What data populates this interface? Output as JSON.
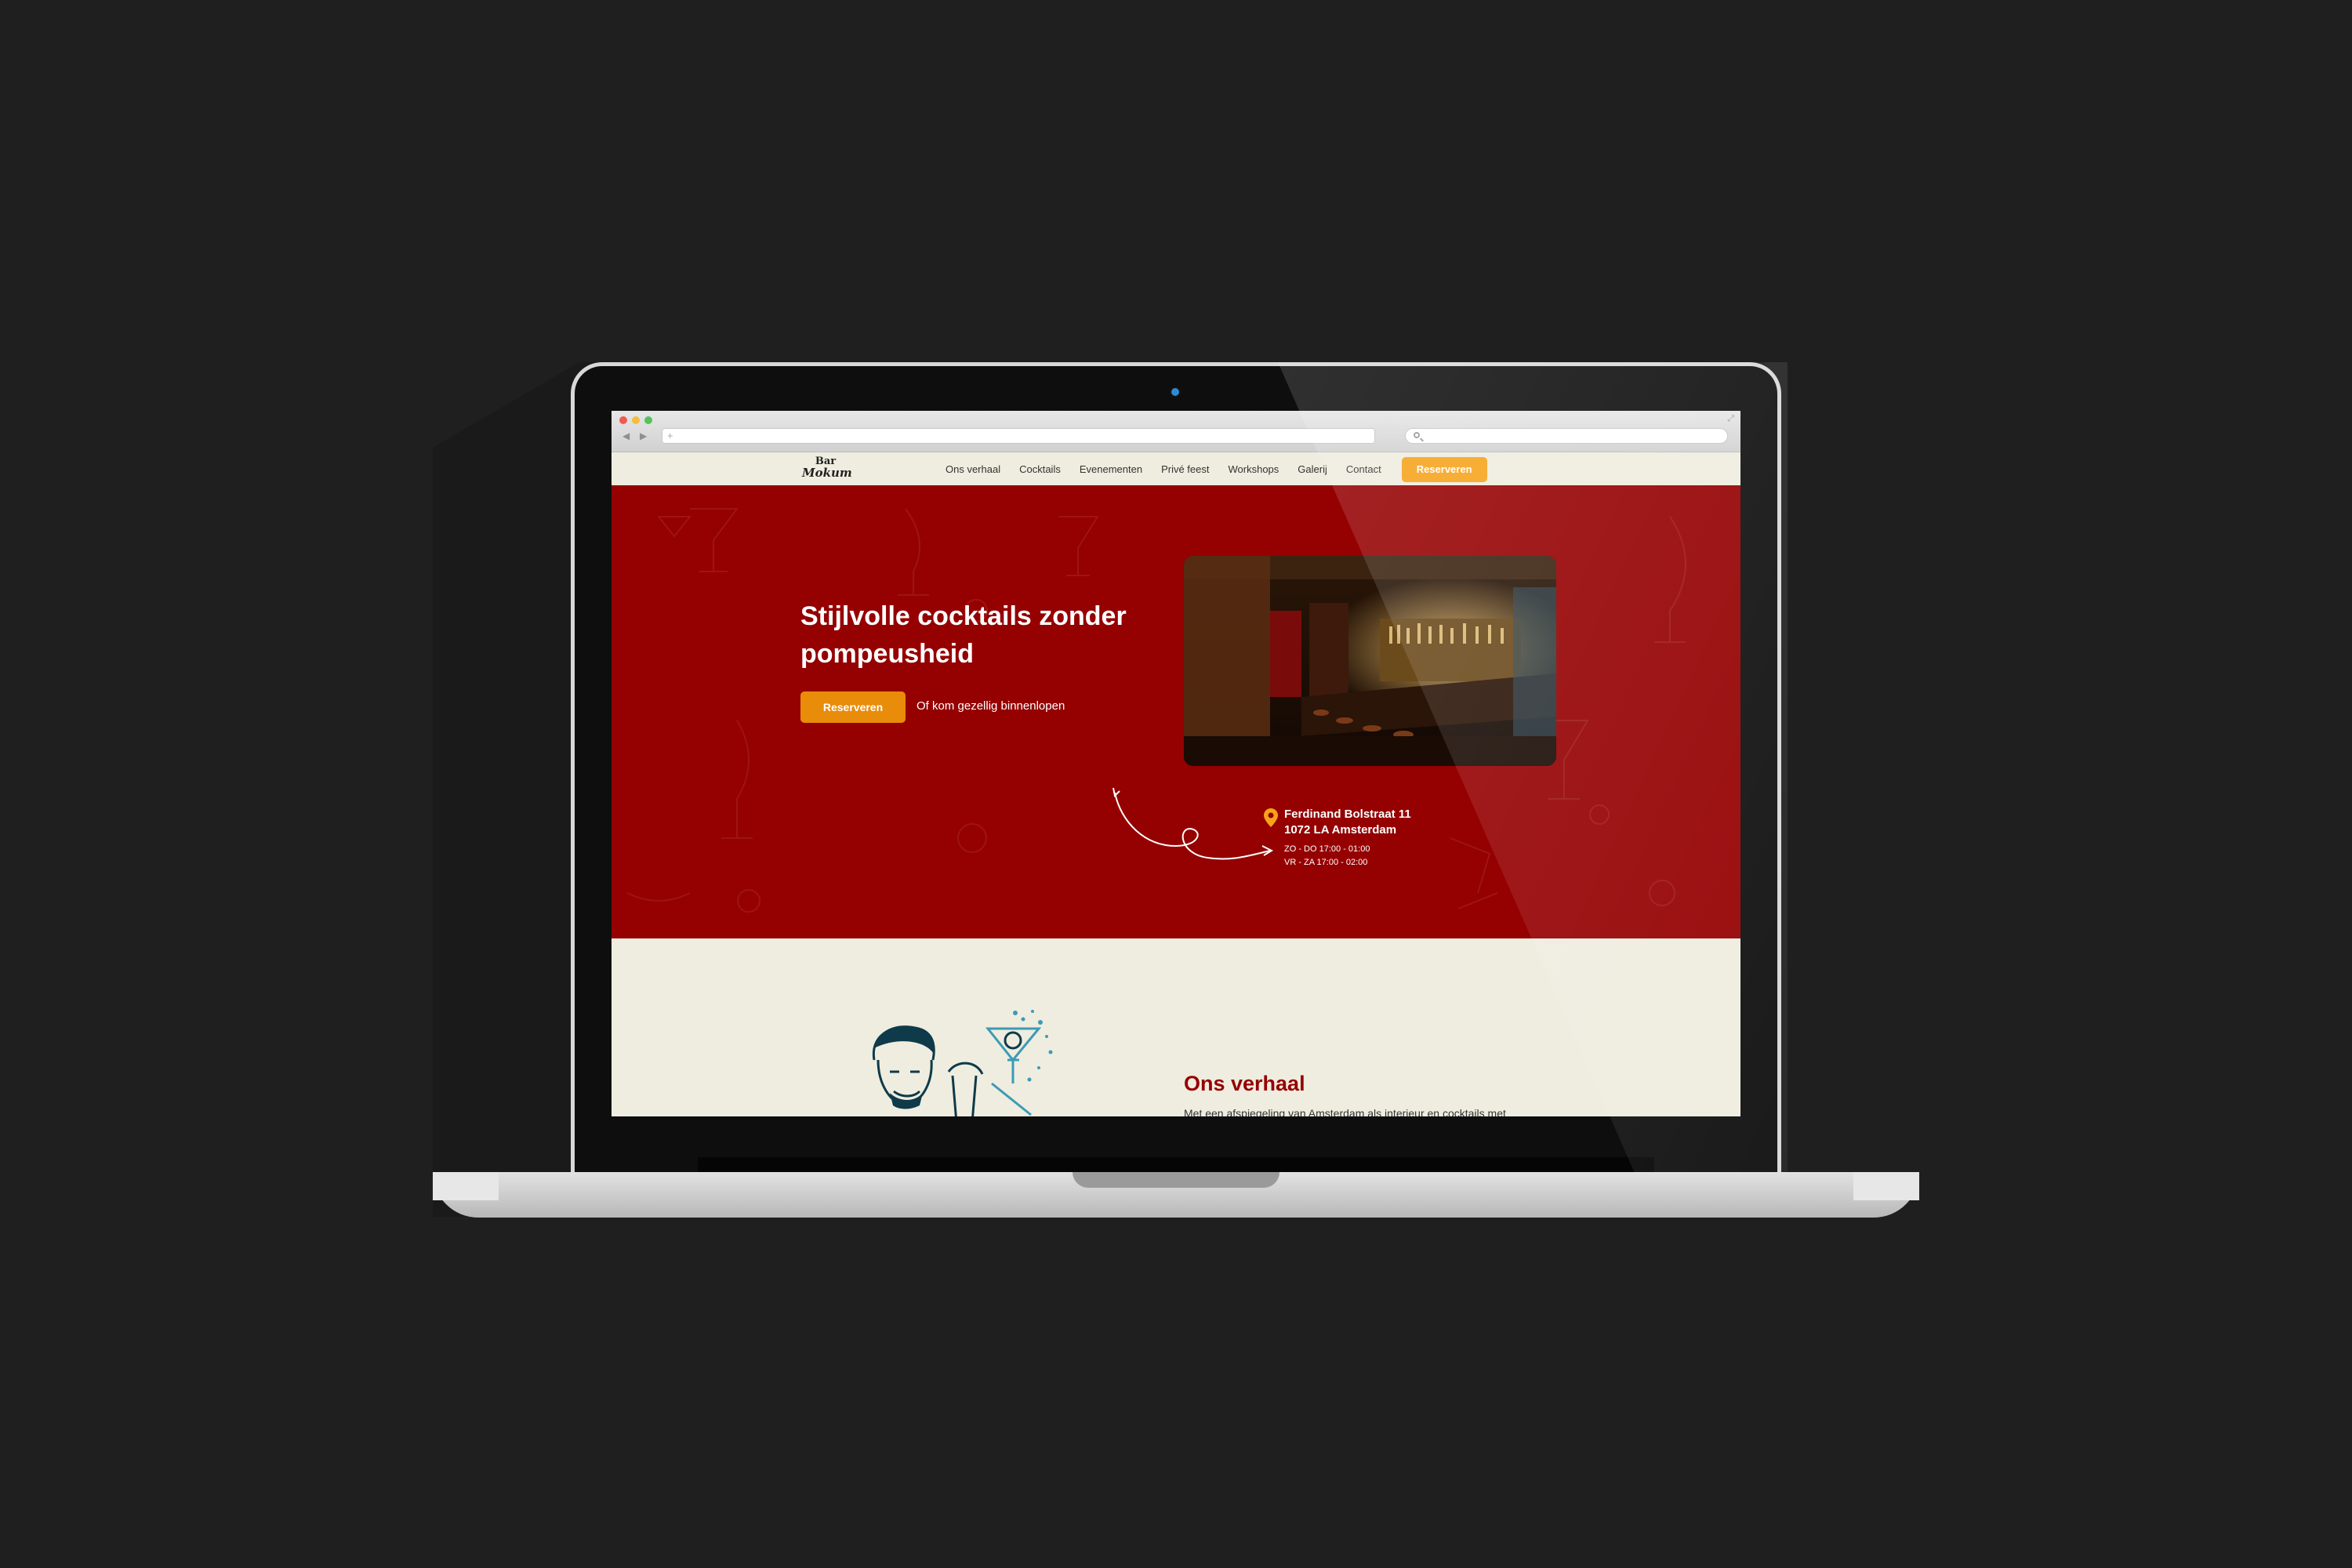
{
  "browser": {
    "back_glyph": "◀",
    "forward_glyph": "▶",
    "new_tab_glyph": "+",
    "address": "",
    "search_value": "",
    "expand_glyph": "⤢"
  },
  "brand": {
    "logo_line1": "Bar",
    "logo_line2": "Mokum"
  },
  "nav": {
    "items": [
      {
        "label": "Ons verhaal"
      },
      {
        "label": "Cocktails"
      },
      {
        "label": "Evenementen"
      },
      {
        "label": "Privé feest"
      },
      {
        "label": "Workshops"
      },
      {
        "label": "Galerij"
      },
      {
        "label": "Contact"
      }
    ],
    "reserve_label": "Reserveren"
  },
  "hero": {
    "title": "Stijlvolle cocktails zonder pompeusheid",
    "button_label": "Reserveren",
    "subtext": "Of kom gezellig binnenlopen",
    "photo_icon": "bar-interior-photo"
  },
  "address": {
    "street": "Ferdinand Bolstraat 11",
    "city": "1072 LA Amsterdam",
    "hours": [
      "ZO - DO 17:00 - 01:00",
      "VR - ZA 17:00 - 02:00"
    ]
  },
  "story": {
    "title": "Ons verhaal",
    "text": "Met een afspiegeling van Amsterdam als interieur en cocktails met"
  },
  "colors": {
    "brand_red": "#950001",
    "accent_orange": "#f6a31b",
    "cream": "#efeddf",
    "icon_blue": "#3b9bb6"
  }
}
